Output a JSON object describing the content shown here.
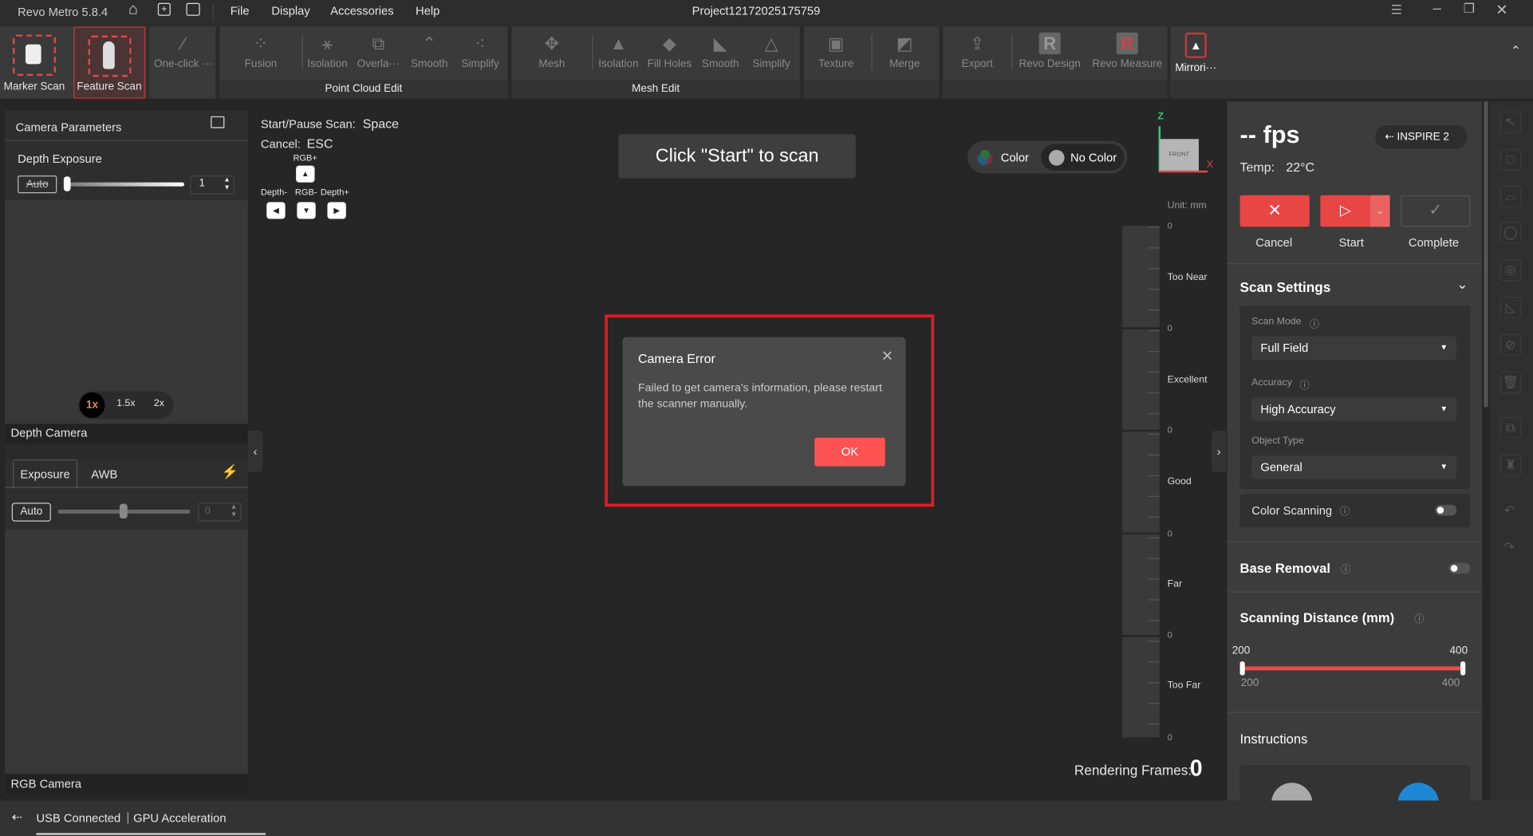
{
  "app": {
    "name": "Revo Metro 5.8.4",
    "project": "Project12172025175759"
  },
  "menu": [
    "File",
    "Display",
    "Accessories",
    "Help"
  ],
  "ribbon": {
    "scan": [
      {
        "label": "Marker Scan"
      },
      {
        "label": "Feature Scan"
      }
    ],
    "one_click": "One-click ···",
    "point_cloud": {
      "label": "Point Cloud Edit",
      "tools": [
        "Fusion",
        "Isolation",
        "Overla···",
        "Smooth",
        "Simplify"
      ]
    },
    "mesh": {
      "label": "Mesh Edit",
      "tools": [
        "Mesh",
        "Isolation",
        "Fill Holes",
        "Smooth",
        "Simplify"
      ]
    },
    "other": [
      "Texture",
      "Merge",
      "Export",
      "Revo Design",
      "Revo Measure",
      "Mirrori···"
    ]
  },
  "left": {
    "camera_parameters": "Camera Parameters",
    "depth_exposure": "Depth Exposure",
    "auto": "Auto",
    "depth_value": "1",
    "zoom": [
      "1x",
      "1.5x",
      "2x"
    ],
    "depth_camera": "Depth Camera",
    "tabs": [
      "Exposure",
      "AWB"
    ],
    "rgb_auto": "Auto",
    "rgb_value": "0",
    "rgb_camera": "RGB Camera"
  },
  "viewport": {
    "shortcut1_label": "Start/Pause Scan:",
    "shortcut1_key": "Space",
    "shortcut2_label": "Cancel:",
    "shortcut2_key": "ESC",
    "keys": {
      "up": "RGB+",
      "left": "Depth-",
      "down": "RGB-",
      "right": "Depth+"
    },
    "hint": "Click \"Start\" to scan",
    "color": "Color",
    "no_color": "No Color",
    "gizmo": {
      "front": "FRONT",
      "x": "X",
      "z": "Z"
    },
    "unit": "Unit: mm",
    "ruler": [
      "Too Near",
      "Excellent",
      "Good",
      "Far",
      "Too Far"
    ],
    "ruler_zero": "0",
    "rendering_label": "Rendering Frames:",
    "rendering_value": "0"
  },
  "dialog": {
    "title": "Camera Error",
    "message": "Failed to get camera's information, please restart the scanner manually.",
    "ok": "OK"
  },
  "right": {
    "fps": "-- fps",
    "device": "INSPIRE 2",
    "temp_label": "Temp:",
    "temp": "22°C",
    "cancel": "Cancel",
    "start": "Start",
    "complete": "Complete",
    "scan_settings": "Scan Settings",
    "scan_mode_label": "Scan Mode",
    "scan_mode": "Full Field",
    "accuracy_label": "Accuracy",
    "accuracy": "High Accuracy",
    "object_type_label": "Object Type",
    "object_type": "General",
    "color_scanning": "Color Scanning",
    "base_removal": "Base Removal",
    "distance_title": "Scanning Distance (mm)",
    "distance_min": "200",
    "distance_max": "400",
    "range_min": "200",
    "range_max": "400",
    "instructions": "Instructions"
  },
  "status": {
    "usb": "USB Connected",
    "gpu": "GPU Acceleration"
  },
  "colors": {
    "accent": "#e84545",
    "ok": "#ff5252",
    "highlight": "#e01c24"
  }
}
